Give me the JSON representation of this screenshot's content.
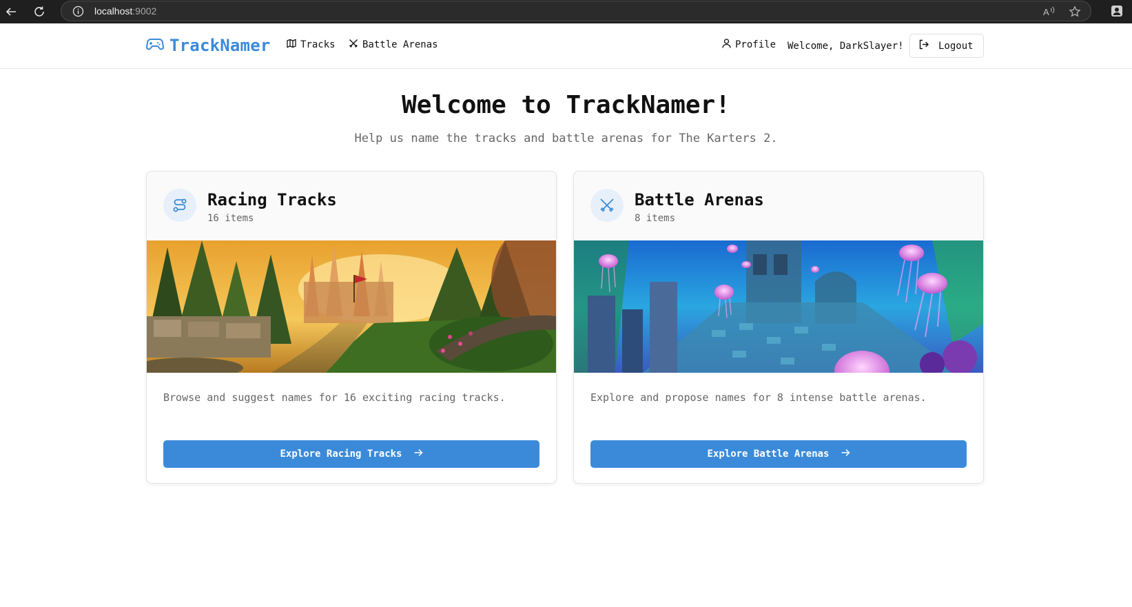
{
  "browser": {
    "url_host": "localhost",
    "url_port": ":9002",
    "icons": [
      "back-arrow-icon",
      "reload-icon",
      "info-icon",
      "read-aloud-icon",
      "favorite-star-icon",
      "profile-icon"
    ]
  },
  "header": {
    "brand": "TrackNamer",
    "nav": [
      {
        "label": "Tracks",
        "icon": "map-icon"
      },
      {
        "label": "Battle Arenas",
        "icon": "crossed-swords-icon"
      }
    ],
    "profile_label": "Profile",
    "welcome": "Welcome, DarkSlayer!",
    "logout_label": "Logout"
  },
  "hero": {
    "title": "Welcome to TrackNamer!",
    "subtitle": "Help us name the tracks and battle arenas for The Karters 2."
  },
  "cards": [
    {
      "title": "Racing Tracks",
      "count": "16 items",
      "description": "Browse and suggest names for 16 exciting racing tracks.",
      "button": "Explore Racing Tracks",
      "icon": "route-icon"
    },
    {
      "title": "Battle Arenas",
      "count": "8 items",
      "description": "Explore and propose names for 8 intense battle arenas.",
      "button": "Explore Battle Arenas",
      "icon": "crossed-swords-icon"
    }
  ],
  "colors": {
    "accent": "#3b8ad9",
    "icon_bg": "#e7f0fa",
    "muted_text": "#666666"
  }
}
